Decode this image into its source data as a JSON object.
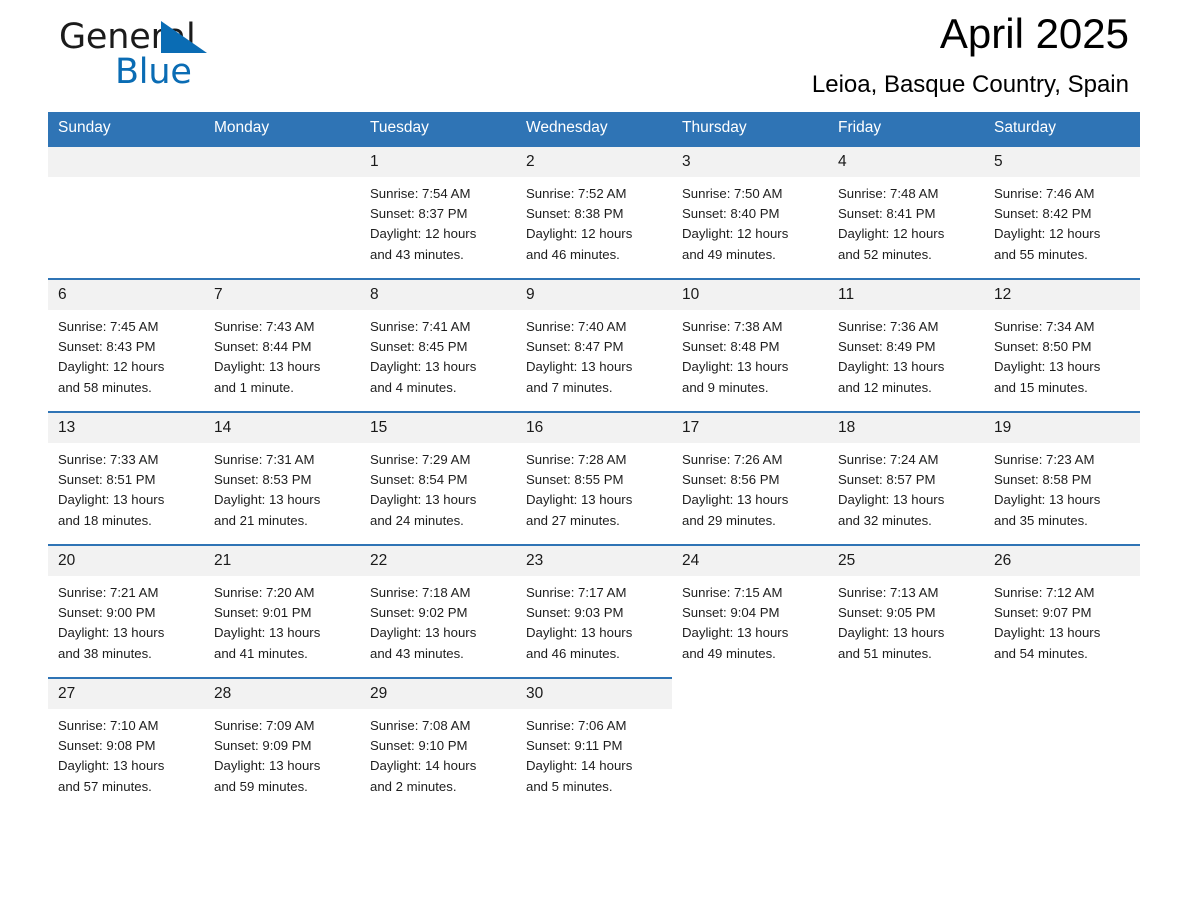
{
  "brand": {
    "name_part1": "General",
    "name_part2": "Blue",
    "accent_color": "#0a6cb4",
    "triangle_icon": "triangle-icon"
  },
  "header": {
    "title": "April 2025",
    "subtitle": "Leioa, Basque Country, Spain"
  },
  "calendar": {
    "header_bg": "#2f74b5",
    "daynum_bg": "#f2f2f2",
    "weekdays": [
      "Sunday",
      "Monday",
      "Tuesday",
      "Wednesday",
      "Thursday",
      "Friday",
      "Saturday"
    ],
    "weeks": [
      [
        {
          "day": "",
          "empty": true
        },
        {
          "day": "",
          "empty": true
        },
        {
          "day": "1",
          "sunrise": "Sunrise: 7:54 AM",
          "sunset": "Sunset: 8:37 PM",
          "daylight1": "Daylight: 12 hours",
          "daylight2": "and 43 minutes."
        },
        {
          "day": "2",
          "sunrise": "Sunrise: 7:52 AM",
          "sunset": "Sunset: 8:38 PM",
          "daylight1": "Daylight: 12 hours",
          "daylight2": "and 46 minutes."
        },
        {
          "day": "3",
          "sunrise": "Sunrise: 7:50 AM",
          "sunset": "Sunset: 8:40 PM",
          "daylight1": "Daylight: 12 hours",
          "daylight2": "and 49 minutes."
        },
        {
          "day": "4",
          "sunrise": "Sunrise: 7:48 AM",
          "sunset": "Sunset: 8:41 PM",
          "daylight1": "Daylight: 12 hours",
          "daylight2": "and 52 minutes."
        },
        {
          "day": "5",
          "sunrise": "Sunrise: 7:46 AM",
          "sunset": "Sunset: 8:42 PM",
          "daylight1": "Daylight: 12 hours",
          "daylight2": "and 55 minutes."
        }
      ],
      [
        {
          "day": "6",
          "sunrise": "Sunrise: 7:45 AM",
          "sunset": "Sunset: 8:43 PM",
          "daylight1": "Daylight: 12 hours",
          "daylight2": "and 58 minutes."
        },
        {
          "day": "7",
          "sunrise": "Sunrise: 7:43 AM",
          "sunset": "Sunset: 8:44 PM",
          "daylight1": "Daylight: 13 hours",
          "daylight2": "and 1 minute."
        },
        {
          "day": "8",
          "sunrise": "Sunrise: 7:41 AM",
          "sunset": "Sunset: 8:45 PM",
          "daylight1": "Daylight: 13 hours",
          "daylight2": "and 4 minutes."
        },
        {
          "day": "9",
          "sunrise": "Sunrise: 7:40 AM",
          "sunset": "Sunset: 8:47 PM",
          "daylight1": "Daylight: 13 hours",
          "daylight2": "and 7 minutes."
        },
        {
          "day": "10",
          "sunrise": "Sunrise: 7:38 AM",
          "sunset": "Sunset: 8:48 PM",
          "daylight1": "Daylight: 13 hours",
          "daylight2": "and 9 minutes."
        },
        {
          "day": "11",
          "sunrise": "Sunrise: 7:36 AM",
          "sunset": "Sunset: 8:49 PM",
          "daylight1": "Daylight: 13 hours",
          "daylight2": "and 12 minutes."
        },
        {
          "day": "12",
          "sunrise": "Sunrise: 7:34 AM",
          "sunset": "Sunset: 8:50 PM",
          "daylight1": "Daylight: 13 hours",
          "daylight2": "and 15 minutes."
        }
      ],
      [
        {
          "day": "13",
          "sunrise": "Sunrise: 7:33 AM",
          "sunset": "Sunset: 8:51 PM",
          "daylight1": "Daylight: 13 hours",
          "daylight2": "and 18 minutes."
        },
        {
          "day": "14",
          "sunrise": "Sunrise: 7:31 AM",
          "sunset": "Sunset: 8:53 PM",
          "daylight1": "Daylight: 13 hours",
          "daylight2": "and 21 minutes."
        },
        {
          "day": "15",
          "sunrise": "Sunrise: 7:29 AM",
          "sunset": "Sunset: 8:54 PM",
          "daylight1": "Daylight: 13 hours",
          "daylight2": "and 24 minutes."
        },
        {
          "day": "16",
          "sunrise": "Sunrise: 7:28 AM",
          "sunset": "Sunset: 8:55 PM",
          "daylight1": "Daylight: 13 hours",
          "daylight2": "and 27 minutes."
        },
        {
          "day": "17",
          "sunrise": "Sunrise: 7:26 AM",
          "sunset": "Sunset: 8:56 PM",
          "daylight1": "Daylight: 13 hours",
          "daylight2": "and 29 minutes."
        },
        {
          "day": "18",
          "sunrise": "Sunrise: 7:24 AM",
          "sunset": "Sunset: 8:57 PM",
          "daylight1": "Daylight: 13 hours",
          "daylight2": "and 32 minutes."
        },
        {
          "day": "19",
          "sunrise": "Sunrise: 7:23 AM",
          "sunset": "Sunset: 8:58 PM",
          "daylight1": "Daylight: 13 hours",
          "daylight2": "and 35 minutes."
        }
      ],
      [
        {
          "day": "20",
          "sunrise": "Sunrise: 7:21 AM",
          "sunset": "Sunset: 9:00 PM",
          "daylight1": "Daylight: 13 hours",
          "daylight2": "and 38 minutes."
        },
        {
          "day": "21",
          "sunrise": "Sunrise: 7:20 AM",
          "sunset": "Sunset: 9:01 PM",
          "daylight1": "Daylight: 13 hours",
          "daylight2": "and 41 minutes."
        },
        {
          "day": "22",
          "sunrise": "Sunrise: 7:18 AM",
          "sunset": "Sunset: 9:02 PM",
          "daylight1": "Daylight: 13 hours",
          "daylight2": "and 43 minutes."
        },
        {
          "day": "23",
          "sunrise": "Sunrise: 7:17 AM",
          "sunset": "Sunset: 9:03 PM",
          "daylight1": "Daylight: 13 hours",
          "daylight2": "and 46 minutes."
        },
        {
          "day": "24",
          "sunrise": "Sunrise: 7:15 AM",
          "sunset": "Sunset: 9:04 PM",
          "daylight1": "Daylight: 13 hours",
          "daylight2": "and 49 minutes."
        },
        {
          "day": "25",
          "sunrise": "Sunrise: 7:13 AM",
          "sunset": "Sunset: 9:05 PM",
          "daylight1": "Daylight: 13 hours",
          "daylight2": "and 51 minutes."
        },
        {
          "day": "26",
          "sunrise": "Sunrise: 7:12 AM",
          "sunset": "Sunset: 9:07 PM",
          "daylight1": "Daylight: 13 hours",
          "daylight2": "and 54 minutes."
        }
      ],
      [
        {
          "day": "27",
          "sunrise": "Sunrise: 7:10 AM",
          "sunset": "Sunset: 9:08 PM",
          "daylight1": "Daylight: 13 hours",
          "daylight2": "and 57 minutes."
        },
        {
          "day": "28",
          "sunrise": "Sunrise: 7:09 AM",
          "sunset": "Sunset: 9:09 PM",
          "daylight1": "Daylight: 13 hours",
          "daylight2": "and 59 minutes."
        },
        {
          "day": "29",
          "sunrise": "Sunrise: 7:08 AM",
          "sunset": "Sunset: 9:10 PM",
          "daylight1": "Daylight: 14 hours",
          "daylight2": "and 2 minutes."
        },
        {
          "day": "30",
          "sunrise": "Sunrise: 7:06 AM",
          "sunset": "Sunset: 9:11 PM",
          "daylight1": "Daylight: 14 hours",
          "daylight2": "and 5 minutes."
        },
        {
          "day": "",
          "blank": true
        },
        {
          "day": "",
          "blank": true
        },
        {
          "day": "",
          "blank": true
        }
      ]
    ]
  }
}
